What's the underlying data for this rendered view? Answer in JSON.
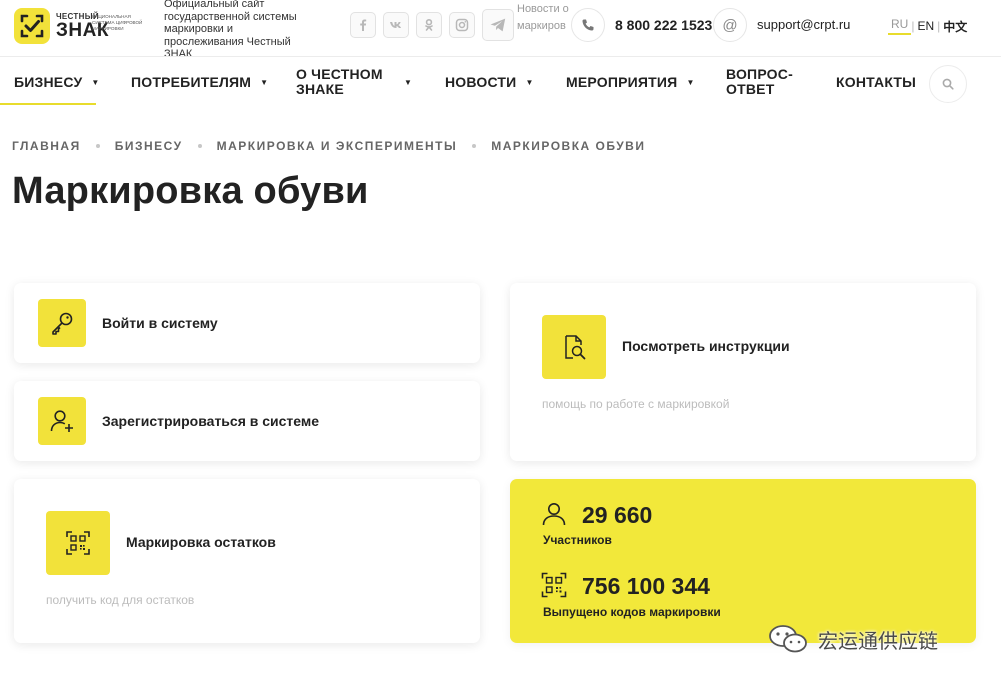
{
  "header": {
    "logo_small": "ЧЕСТНЫЙ",
    "logo_big": "ЗНАК",
    "logo_sub": "НАЦИОНАЛЬНАЯ СИСТЕМА ЦИФРОВОЙ МАРКИРОВКИ",
    "official_text": "Официальный сайт государственной системы маркировки и прослеживания Честный ЗНАК",
    "socials": [
      "facebook-icon",
      "vk-icon",
      "odnoklassniki-icon",
      "instagram-icon",
      "telegram-icon"
    ],
    "telegram_news": "Новости о маркиров",
    "phone": "8 800 222 1523",
    "email": "support@crpt.ru",
    "languages": [
      {
        "code": "RU",
        "active": true
      },
      {
        "code": "EN",
        "active": false
      },
      {
        "code": "中文",
        "active": false
      }
    ]
  },
  "nav": {
    "items": [
      {
        "label": "БИЗНЕСУ",
        "active": true
      },
      {
        "label": "ПОТРЕБИТЕЛЯМ"
      },
      {
        "label": "О ЧЕСТНОМ ЗНАКЕ"
      },
      {
        "label": "НОВОСТИ"
      },
      {
        "label": "МЕРОПРИЯТИЯ"
      },
      {
        "label": "ВОПРОС-ОТВЕТ"
      },
      {
        "label": "КОНТАКТЫ"
      }
    ]
  },
  "breadcrumb": [
    "ГЛАВНАЯ",
    "БИЗНЕСУ",
    "МАРКИРОВКА И ЭКСПЕРИМЕНТЫ",
    "МАРКИРОВКА ОБУВИ"
  ],
  "page_title": "Маркировка обуви",
  "cards": {
    "login": {
      "label": "Войти в систему",
      "icon": "key-icon"
    },
    "register": {
      "label": "Зарегистрироваться в системе",
      "icon": "user-plus-icon"
    },
    "instructions": {
      "label": "Посмотреть инструкции",
      "sub": "помощь по работе с маркировкой",
      "icon": "document-search-icon"
    },
    "remains": {
      "label": "Маркировка остатков",
      "sub": "получить код для остатков",
      "icon": "qr-code-icon"
    }
  },
  "stats": {
    "participants_value": "29 660",
    "participants_label": "Участников",
    "codes_value": "756 100 344",
    "codes_label": "Выпущено кодов маркировки"
  },
  "watermark": "宏运通供应链",
  "colors": {
    "accent": "#f2e23a",
    "stats_bg": "#f2e83a",
    "text": "#222222",
    "muted": "#bcbcbc"
  }
}
